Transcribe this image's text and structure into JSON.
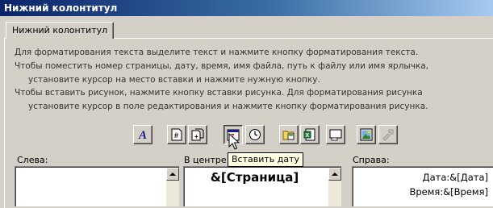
{
  "window": {
    "title": "Нижний колонтитул"
  },
  "tab": {
    "label": "Нижний колонтитул"
  },
  "instructions": [
    "Для форматирования текста выделите текст и нажмите кнопку форматирования текста.",
    "Чтобы поместить номер страницы, дату, время, имя файла, путь к файлу или имя ярлычка,",
    "установите курсор на место вставки и нажмите нужную кнопку.",
    "Чтобы вставить рисунок, нажмите кнопку вставки рисунка.  Для форматирования рисунка",
    "установите курсор в поле редактирования и нажмите кнопку форматирования рисунка."
  ],
  "toolbar": {
    "buttons": [
      {
        "icon": "format-text-icon",
        "glyph": "A"
      },
      {
        "icon": "insert-page-number-icon",
        "glyph": "#"
      },
      {
        "icon": "insert-total-pages-icon",
        "glyph": "+"
      },
      {
        "icon": "insert-date-icon",
        "glyph": "7"
      },
      {
        "icon": "insert-time-icon"
      },
      {
        "icon": "insert-file-path-icon"
      },
      {
        "icon": "insert-file-name-icon"
      },
      {
        "icon": "insert-sheet-name-icon"
      },
      {
        "icon": "insert-picture-icon"
      },
      {
        "icon": "format-picture-icon"
      }
    ],
    "tooltip": "Вставить дату"
  },
  "sections": {
    "left": {
      "label": "Слева:",
      "content": ""
    },
    "center": {
      "label": "В центре:",
      "content": "&[Страница]"
    },
    "right": {
      "label": "Справа:",
      "lines": [
        "Дата:&[Дата]",
        "Время:&[Время]"
      ]
    }
  },
  "colors": {
    "title_gradient_start": "#0a246a",
    "title_gradient_end": "#a6caf0",
    "face": "#d4d0c8",
    "tooltip_bg": "#ffffe1"
  }
}
